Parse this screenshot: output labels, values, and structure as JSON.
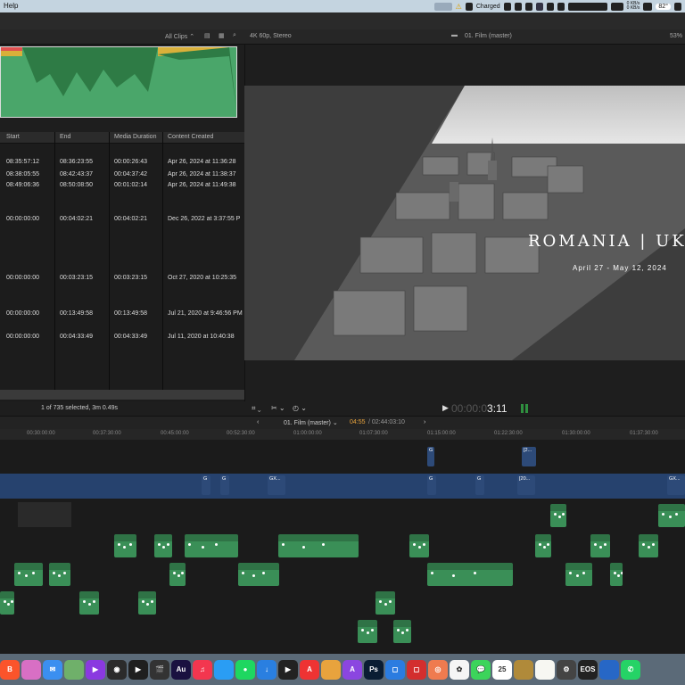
{
  "menubar": {
    "help": "Help",
    "battery_status": "Charged",
    "net_up": "0 KB/s",
    "net_down": "0 KB/s",
    "temp": "82°"
  },
  "browser": {
    "filter_label": "All Clips",
    "columns": [
      "Start",
      "End",
      "Media Duration",
      "Content Created"
    ],
    "rows": [
      {
        "start": "08:35:57:12",
        "end": "08:36:23:55",
        "duration": "00:00:26:43",
        "created": "Apr 26, 2024 at 11:36:28"
      },
      {
        "start": "08:38:05:55",
        "end": "08:42:43:37",
        "duration": "00:04:37:42",
        "created": "Apr 26, 2024 at 11:38:37"
      },
      {
        "start": "08:49:06:36",
        "end": "08:50:08:50",
        "duration": "00:01:02:14",
        "created": "Apr 26, 2024 at 11:49:38"
      },
      {
        "start": "00:00:00:00",
        "end": "00:04:02:21",
        "duration": "00:04:02:21",
        "created": "Dec 26, 2022 at 3:37:55 P"
      },
      {
        "start": "00:00:00:00",
        "end": "00:03:23:15",
        "duration": "00:03:23:15",
        "created": "Oct 27, 2020 at 10:25:35"
      },
      {
        "start": "00:00:00:00",
        "end": "00:13:49:58",
        "duration": "00:13:49:58",
        "created": "Jul 21, 2020 at 9:46:56 PM"
      },
      {
        "start": "00:00:00:00",
        "end": "00:04:33:49",
        "duration": "00:04:33:49",
        "created": "Jul 11, 2020 at 10:40:38"
      },
      {
        "start": "00:00:00:00",
        "end": "00:03:00:39",
        "duration": "00:03:00:39",
        "created": "Mar 23, 2020 at 5:22:05 P"
      }
    ],
    "footer": "1 of 735 selected, 3m 0.49s"
  },
  "viewer": {
    "format": "4K 60p, Stereo",
    "project": "01. Film (master)",
    "zoom": "53%",
    "overlay_title": "ROMANIA | UK",
    "overlay_dates": "April 27 - May 12, 2024",
    "timecode_dim": "00:00:0",
    "timecode_bright": "3:11"
  },
  "timeline": {
    "project": "01. Film (master)",
    "position": "04:55",
    "total": "/ 02:44:03:10",
    "ruler": [
      "00:30:00:00",
      "00:37:30:00",
      "00:45:00:00",
      "00:52:30:00",
      "01:00:00:00",
      "01:07:30:00",
      "01:15:00:00",
      "01:22:30:00",
      "01:30:00:00",
      "01:37:30:00"
    ],
    "clips": [
      {
        "label": "G",
        "lane": 0,
        "start": 479,
        "w": 8,
        "type": "b"
      },
      {
        "label": "[2...",
        "lane": 0,
        "start": 585,
        "w": 16,
        "type": "b"
      },
      {
        "label": "GX...",
        "lane": 1,
        "start": 300,
        "w": 20,
        "type": "b"
      },
      {
        "label": "G",
        "lane": 1,
        "start": 226,
        "w": 10,
        "type": "b"
      },
      {
        "label": "G",
        "lane": 1,
        "start": 247,
        "w": 10,
        "type": "b"
      },
      {
        "label": "G",
        "lane": 1,
        "start": 479,
        "w": 10,
        "type": "b"
      },
      {
        "label": "G",
        "lane": 1,
        "start": 533,
        "w": 10,
        "type": "b"
      },
      {
        "label": "[20...",
        "lane": 1,
        "start": 580,
        "w": 20,
        "type": "b"
      },
      {
        "label": "GX...",
        "lane": 1,
        "start": 748,
        "w": 20,
        "type": "b"
      },
      {
        "label": "Tra...",
        "lane": 2,
        "start": 617,
        "w": 18,
        "type": "g"
      },
      {
        "label": "Dancer",
        "lane": 2,
        "start": 738,
        "w": 30,
        "type": "g"
      },
      {
        "label": "If I...",
        "lane": 3,
        "start": 128,
        "w": 25,
        "type": "g"
      },
      {
        "label": "Stre...",
        "lane": 3,
        "start": 173,
        "w": 20,
        "type": "g"
      },
      {
        "label": "In The Moment",
        "lane": 3,
        "start": 207,
        "w": 60,
        "type": "g"
      },
      {
        "label": "In The Moment",
        "lane": 3,
        "start": 312,
        "w": 90,
        "type": "g"
      },
      {
        "label": "Gen...",
        "lane": 3,
        "start": 459,
        "w": 22,
        "type": "g"
      },
      {
        "label": "Tra...",
        "lane": 3,
        "start": 600,
        "w": 18,
        "type": "g"
      },
      {
        "label": "Glad...",
        "lane": 3,
        "start": 662,
        "w": 22,
        "type": "g"
      },
      {
        "label": "Violet",
        "lane": 3,
        "start": 716,
        "w": 22,
        "type": "g"
      },
      {
        "label": "Bueno F...",
        "lane": 4,
        "start": 16,
        "w": 32,
        "type": "g"
      },
      {
        "label": "Artis...",
        "lane": 4,
        "start": 55,
        "w": 24,
        "type": "g"
      },
      {
        "label": "Lat...",
        "lane": 4,
        "start": 190,
        "w": 18,
        "type": "g"
      },
      {
        "label": "In The Moment",
        "lane": 4,
        "start": 267,
        "w": 46,
        "type": "g"
      },
      {
        "label": "Coffee Shop Outdoor In Autumn P...",
        "lane": 4,
        "start": 479,
        "w": 96,
        "type": "g"
      },
      {
        "label": "We'll Ke...",
        "lane": 4,
        "start": 634,
        "w": 30,
        "type": "g"
      },
      {
        "label": "Pl...",
        "lane": 4,
        "start": 684,
        "w": 14,
        "type": "g"
      },
      {
        "label": "River",
        "lane": 5,
        "start": 0,
        "w": 16,
        "type": "g"
      },
      {
        "label": "Alle...",
        "lane": 5,
        "start": 89,
        "w": 22,
        "type": "g"
      },
      {
        "label": "Stre...",
        "lane": 5,
        "start": 155,
        "w": 20,
        "type": "g"
      },
      {
        "label": "Colo...",
        "lane": 5,
        "start": 421,
        "w": 22,
        "type": "g"
      },
      {
        "label": "Colo...",
        "lane": 6,
        "start": 401,
        "w": 22,
        "type": "g"
      },
      {
        "label": "Col...",
        "lane": 6,
        "start": 441,
        "w": 20,
        "type": "g"
      }
    ]
  },
  "dock": [
    {
      "name": "brave-icon",
      "color": "#fb542b",
      "glyph": "B"
    },
    {
      "name": "app-icon",
      "color": "#d86fc4",
      "glyph": ""
    },
    {
      "name": "mail-icon",
      "color": "#3b8ff0",
      "glyph": "✉"
    },
    {
      "name": "app-icon",
      "color": "#6fb06a",
      "glyph": ""
    },
    {
      "name": "app-icon",
      "color": "#8a39e0",
      "glyph": "▶"
    },
    {
      "name": "app-icon",
      "color": "#2b2b2b",
      "glyph": "◉"
    },
    {
      "name": "motion-icon",
      "color": "#1f1f1f",
      "glyph": "▶"
    },
    {
      "name": "final-cut-icon",
      "color": "#333",
      "glyph": "🎬"
    },
    {
      "name": "audition-icon",
      "color": "#1a1140",
      "glyph": "Au"
    },
    {
      "name": "music-icon",
      "color": "#f3364f",
      "glyph": "♫"
    },
    {
      "name": "app-icon",
      "color": "#2a9df4",
      "glyph": ""
    },
    {
      "name": "spotify-icon",
      "color": "#1ed760",
      "glyph": "●"
    },
    {
      "name": "download-icon",
      "color": "#2a7fe0",
      "glyph": "↓"
    },
    {
      "name": "app-icon",
      "color": "#222",
      "glyph": "▶"
    },
    {
      "name": "app-icon",
      "color": "#e33",
      "glyph": "A"
    },
    {
      "name": "app-icon",
      "color": "#e8a33d",
      "glyph": ""
    },
    {
      "name": "affinity-icon",
      "color": "#8b46e0",
      "glyph": "A"
    },
    {
      "name": "photoshop-icon",
      "color": "#0a1d33",
      "glyph": "Ps"
    },
    {
      "name": "app-icon",
      "color": "#2b7ce0",
      "glyph": "◻"
    },
    {
      "name": "app-icon",
      "color": "#d32e2e",
      "glyph": "◻"
    },
    {
      "name": "app-icon",
      "color": "#ef7b4f",
      "glyph": "◎"
    },
    {
      "name": "photos-icon",
      "color": "#f5f5f5",
      "glyph": "✿"
    },
    {
      "name": "messages-icon",
      "color": "#3cd45b",
      "glyph": "💬"
    },
    {
      "name": "calendar-icon",
      "color": "#ffffff",
      "glyph": "25"
    },
    {
      "name": "app-icon",
      "color": "#b08a3a",
      "glyph": ""
    },
    {
      "name": "notes-icon",
      "color": "#f7f7f2",
      "glyph": ""
    },
    {
      "name": "app-icon",
      "color": "#444",
      "glyph": "⚙"
    },
    {
      "name": "eos-webcam-icon",
      "color": "#222",
      "glyph": "EOS"
    },
    {
      "name": "app-icon",
      "color": "#2767c6",
      "glyph": ""
    },
    {
      "name": "whatsapp-icon",
      "color": "#25d366",
      "glyph": "✆"
    }
  ]
}
